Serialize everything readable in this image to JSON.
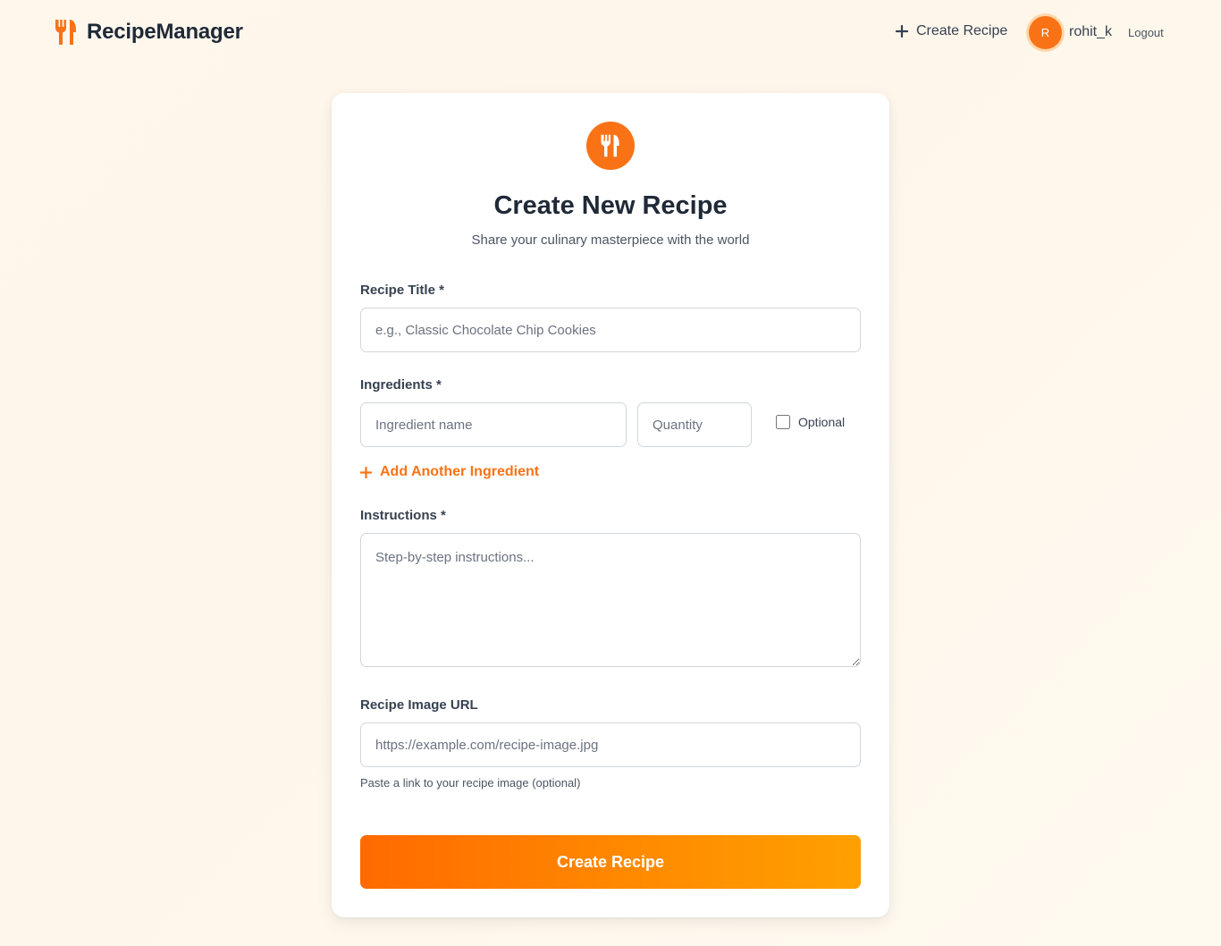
{
  "header": {
    "brand_name": "RecipeManager",
    "nav_create_label": "Create Recipe",
    "avatar_initial": "R",
    "username": "rohit_k",
    "logout_label": "Logout",
    "accent_color": "#f97316",
    "brand_icon": "fork-knife-icon"
  },
  "form": {
    "icon": "fork-knife-icon",
    "title": "Create New Recipe",
    "subtitle": "Share your culinary masterpiece with the world",
    "recipe_title": {
      "label": "Recipe Title *",
      "placeholder": "e.g., Classic Chocolate Chip Cookies",
      "value": ""
    },
    "ingredients": {
      "label": "Ingredients *",
      "name_placeholder": "Ingredient name",
      "quantity_placeholder": "Quantity",
      "optional_label": "Optional",
      "optional_checked": false,
      "add_label": "Add Another Ingredient"
    },
    "instructions": {
      "label": "Instructions *",
      "placeholder": "Step-by-step instructions...",
      "value": ""
    },
    "image_url": {
      "label": "Recipe Image URL",
      "placeholder": "https://example.com/recipe-image.jpg",
      "hint": "Paste a link to your recipe image (optional)",
      "value": ""
    },
    "submit_label": "Create Recipe"
  }
}
